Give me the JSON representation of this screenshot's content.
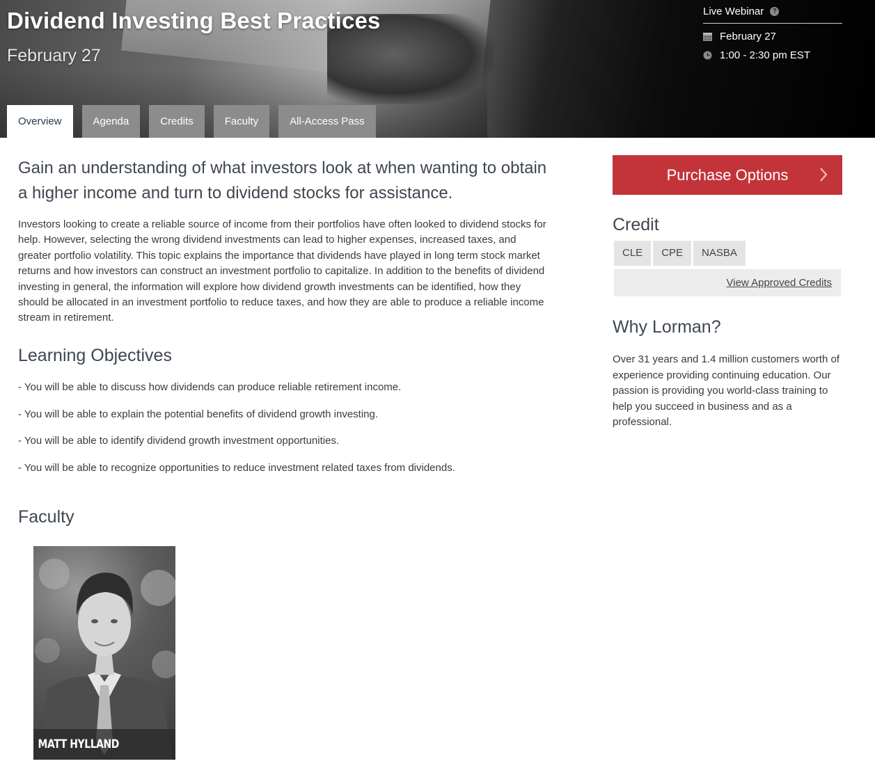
{
  "header": {
    "title": "Dividend Investing Best Practices",
    "date": "February 27"
  },
  "webinar": {
    "type": "Live Webinar",
    "date": "February 27",
    "time": "1:00 - 2:30 pm EST"
  },
  "tabs": [
    {
      "label": "Overview",
      "active": true
    },
    {
      "label": "Agenda"
    },
    {
      "label": "Credits"
    },
    {
      "label": "Faculty"
    },
    {
      "label": "All-Access Pass"
    }
  ],
  "overview": {
    "lead": "Gain an understanding of what investors look at when wanting to obtain a higher income and turn to dividend stocks for assistance.",
    "description": "Investors looking to create a reliable source of income from their portfolios have often looked to dividend stocks for help. However, selecting the wrong dividend investments can lead to higher expenses, increased taxes, and greater portfolio volatility. This topic explains the importance that dividends have played in long term stock market returns and how investors can construct an investment portfolio to capitalize. In addition to the benefits of dividend investing in general, the information will explore how dividend growth investments can be identified, how they should be allocated in an investment portfolio to reduce taxes, and how they are able to produce a reliable income stream in retirement."
  },
  "objectives": {
    "title": "Learning Objectives",
    "items": [
      "- You will be able to discuss how dividends can produce reliable retirement income.",
      "- You will be able to explain the potential benefits of dividend growth investing.",
      "- You will be able to identify dividend growth investment opportunities.",
      "- You will be able to recognize opportunities to reduce investment related taxes from dividends."
    ]
  },
  "faculty": {
    "title": "Faculty",
    "name": "MATT HYLLAND"
  },
  "sidebar": {
    "purchase_label": "Purchase Options",
    "credit_title": "Credit",
    "credits": [
      "CLE",
      "CPE",
      "NASBA"
    ],
    "view_credits": "View Approved Credits",
    "why_title": "Why Lorman?",
    "why_text": "Over 31 years and 1.4 million customers worth of experience providing continuing education. Our passion is providing you world-class training to help you succeed in business and as a professional."
  },
  "colors": {
    "accent": "#c3343a",
    "tab_inactive": "#8c8c8c"
  }
}
